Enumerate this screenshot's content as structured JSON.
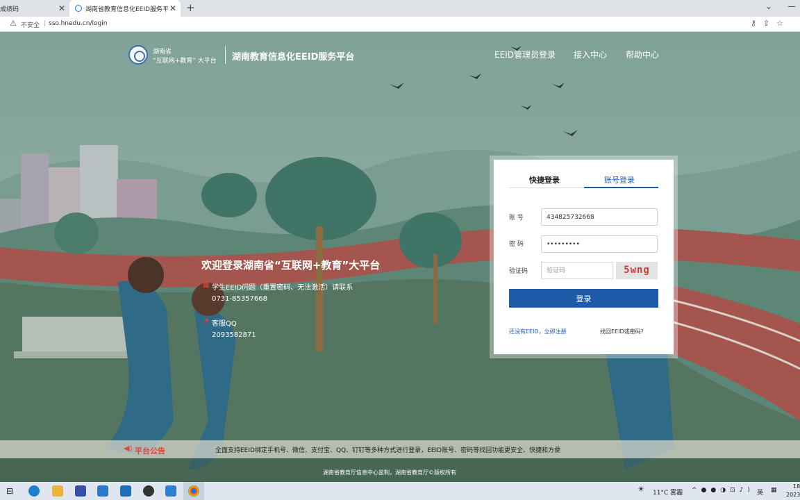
{
  "browser": {
    "tabs": [
      {
        "title": "成绩码"
      },
      {
        "title": "湖南省教育信息化EEID服务平台"
      }
    ],
    "new_tab": "+",
    "close": "✕",
    "address": {
      "security": "不安全",
      "separator": "|",
      "url": "sso.hnedu.cn/login"
    }
  },
  "header": {
    "logo_line1": "湖南省",
    "logo_line2": "“互联网+教育” 大平台",
    "site_title": "湖南教育信息化EEID服务平台",
    "nav": [
      "EEID管理员登录",
      "接入中心",
      "帮助中心"
    ]
  },
  "welcome": {
    "title": "欢迎登录湖南省“互联网+教育”大平台",
    "line1": "学生EEID问题（重置密码、无法激活）请联系",
    "phone": "0731-85357668",
    "qq_label": "客服QQ",
    "qq": "2093582871"
  },
  "login": {
    "tab_quick": "快捷登录",
    "tab_account": "账号登录",
    "account_label": "账  号",
    "account_value": "434825732668",
    "password_label": "密  码",
    "password_value": "•••••••••",
    "captcha_label": "验证码",
    "captcha_placeholder": "验证码",
    "captcha_code": "5wng",
    "submit": "登录",
    "register_link": "还没有EEID，立即注册",
    "recover_link": "找回EEID或密码?"
  },
  "notice": {
    "label": "平台公告",
    "text": "全面支持EEID绑定手机号、微信、支付宝、QQ、钉钉等多种方式进行登录，EEID账号、密码等找回功能更安全、快捷和方便"
  },
  "footer": {
    "text": "湖南省教育厅信息中心监制，湖南省教育厅©版权所有"
  },
  "taskbar": {
    "weather": "11°C 雾霾",
    "ime": "英",
    "time": "18",
    "date": "2023"
  },
  "colors": {
    "accent": "#1e5aa8",
    "notice_red": "#e0463a",
    "captcha_red": "#d33b34"
  }
}
